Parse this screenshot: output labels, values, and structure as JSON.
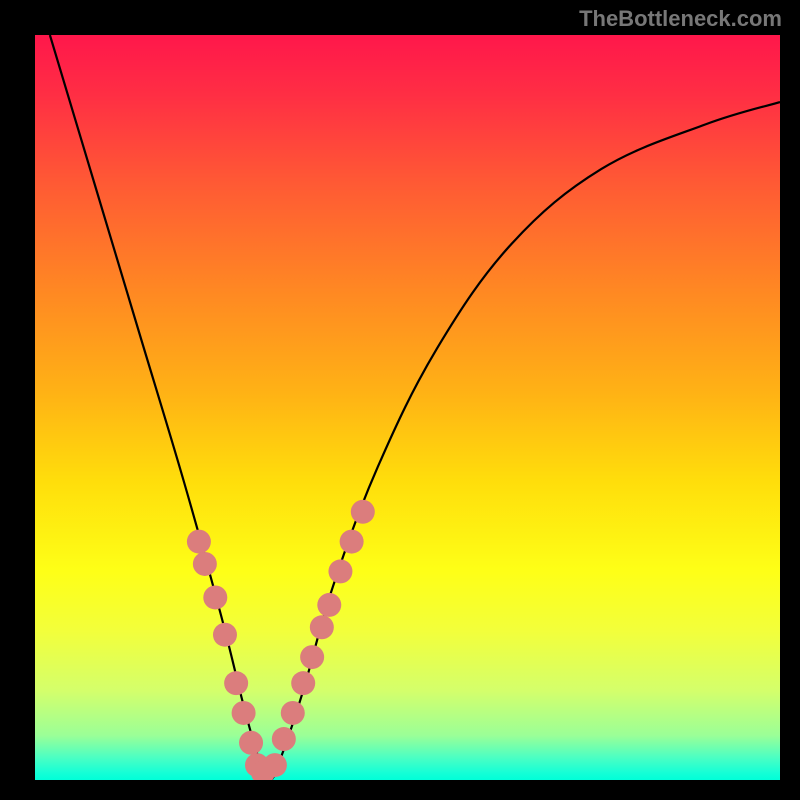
{
  "watermark": "TheBottleneck.com",
  "chart_data": {
    "type": "line",
    "title": "",
    "xlabel": "",
    "ylabel": "",
    "xlim": [
      0,
      100
    ],
    "ylim": [
      0,
      100
    ],
    "grid": false,
    "series": [
      {
        "name": "curve",
        "x": [
          2,
          8,
          14,
          20,
          25,
          28,
          30,
          31.5,
          33,
          36,
          40,
          46,
          54,
          64,
          76,
          90,
          100
        ],
        "y": [
          100,
          80,
          60,
          40,
          22,
          10,
          3,
          0,
          3,
          12,
          26,
          42,
          58,
          72,
          82,
          88,
          91
        ]
      }
    ],
    "markers": {
      "name": "salmon-dots",
      "color": "#db7d7d",
      "radius": 12,
      "x": [
        22.0,
        22.8,
        24.2,
        25.5,
        27.0,
        28.0,
        29.0,
        29.8,
        30.6,
        32.2,
        33.4,
        34.6,
        36.0,
        37.2,
        38.5,
        39.5,
        41.0,
        42.5,
        44.0
      ],
      "y": [
        32.0,
        29.0,
        24.5,
        19.5,
        13.0,
        9.0,
        5.0,
        2.0,
        1.0,
        2.0,
        5.5,
        9.0,
        13.0,
        16.5,
        20.5,
        23.5,
        28.0,
        32.0,
        36.0
      ]
    }
  }
}
